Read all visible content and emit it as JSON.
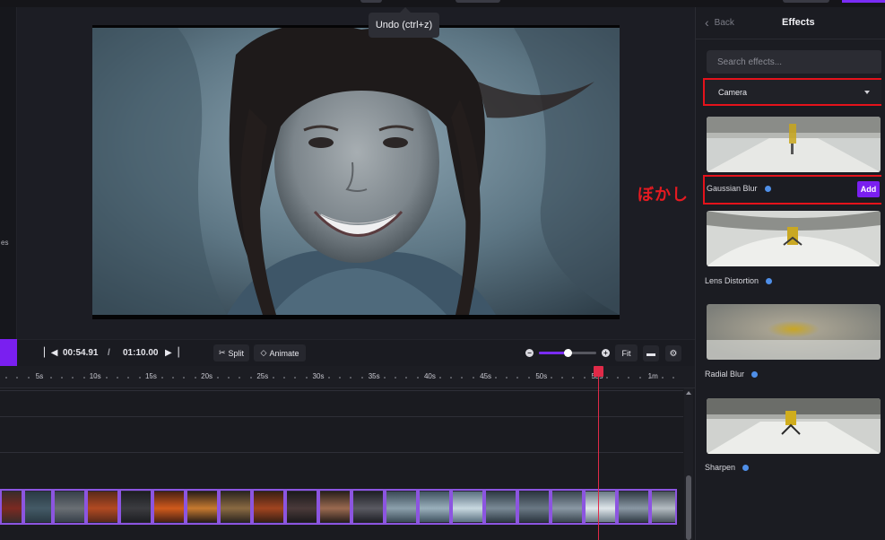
{
  "tooltip": {
    "text": "Undo (ctrl+z)"
  },
  "left_rail": {
    "fragment": "es"
  },
  "effects_panel": {
    "back_label": "Back",
    "title": "Effects",
    "search_placeholder": "Search effects...",
    "category": "Camera",
    "add_label": "Add",
    "items": [
      {
        "label": "Gaussian Blur"
      },
      {
        "label": "Lens Distortion"
      },
      {
        "label": "Radial Blur"
      },
      {
        "label": "Sharpen"
      }
    ]
  },
  "annotation": {
    "text": "ぼかし",
    "color": "#e41a21"
  },
  "transport": {
    "current_time": "00:54.91",
    "separator": "/",
    "total_time": "01:10.00",
    "split_label": "Split",
    "animate_label": "Animate",
    "fit_label": "Fit",
    "zoom_level": 0.5
  },
  "timeline": {
    "ruler_labels": [
      "5s",
      "10s",
      "15s",
      "20s",
      "25s",
      "30s",
      "35s",
      "40s",
      "45s",
      "50s",
      "55s",
      "1m"
    ],
    "playhead_time": "00:54.91"
  },
  "colors": {
    "accent": "#7a1ff0",
    "highlight_red": "#e4121b",
    "playhead": "#e02a48",
    "info": "#4f8fe8"
  }
}
